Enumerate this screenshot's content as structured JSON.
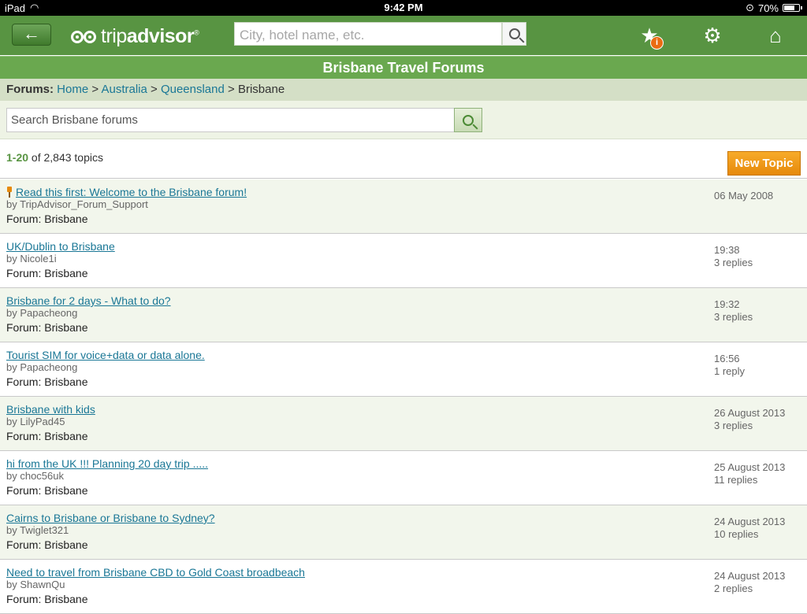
{
  "status": {
    "device": "iPad",
    "time": "9:42 PM",
    "battery": "70%"
  },
  "nav": {
    "back_glyph": "←",
    "logo_trip": "trip",
    "logo_advisor": "advisor",
    "logo_mark": "®",
    "search_placeholder": "City, hotel name, etc.",
    "badge": "i",
    "icons": [
      "star-icon",
      "gear-icon",
      "home-icon"
    ]
  },
  "title": "Brisbane Travel Forums",
  "breadcrumb": {
    "label": "Forums:",
    "items": [
      "Home",
      "Australia",
      "Queensland"
    ],
    "current": "Brisbane",
    "separator": ">"
  },
  "forum_search": {
    "placeholder": "Search Brisbane forums"
  },
  "count": {
    "range": "1-20",
    "rest": " of 2,843 topics"
  },
  "new_topic_label": "New Topic",
  "topics": [
    {
      "title": "Read this first: Welcome to the Brisbane forum!",
      "by": "by TripAdvisor_Forum_Support",
      "forum": "Forum: Brisbane",
      "date": "06 May 2008",
      "replies": "",
      "pinned": true
    },
    {
      "title": "UK/Dublin to Brisbane",
      "by": "by Nicole1i",
      "forum": "Forum: Brisbane",
      "date": "19:38",
      "replies": "3 replies"
    },
    {
      "title": "Brisbane for 2 days - What to do?",
      "by": "by Papacheong",
      "forum": "Forum: Brisbane",
      "date": "19:32",
      "replies": "3 replies"
    },
    {
      "title": "Tourist SIM for voice+data or data alone.",
      "by": "by Papacheong",
      "forum": "Forum: Brisbane",
      "date": "16:56",
      "replies": "1 reply"
    },
    {
      "title": "Brisbane with kids",
      "by": "by LilyPad45",
      "forum": "Forum: Brisbane",
      "date": "26 August 2013",
      "replies": "3 replies"
    },
    {
      "title": "hi from the UK !!! Planning 20 day trip .....",
      "by": "by choc56uk",
      "forum": "Forum: Brisbane",
      "date": "25 August 2013",
      "replies": "11 replies"
    },
    {
      "title": "Cairns to Brisbane or Brisbane to Sydney?",
      "by": "by Twiglet321",
      "forum": "Forum: Brisbane",
      "date": "24 August 2013",
      "replies": "10 replies"
    },
    {
      "title": "Need to travel from Brisbane CBD to Gold Coast broadbeach",
      "by": "by ShawnQu",
      "forum": "Forum: Brisbane",
      "date": "24 August 2013",
      "replies": "2 replies"
    }
  ],
  "colors": {
    "brand_green": "#589442",
    "title_green": "#6aa84f",
    "link": "#1a7796",
    "new_topic": "#f09a1a"
  }
}
